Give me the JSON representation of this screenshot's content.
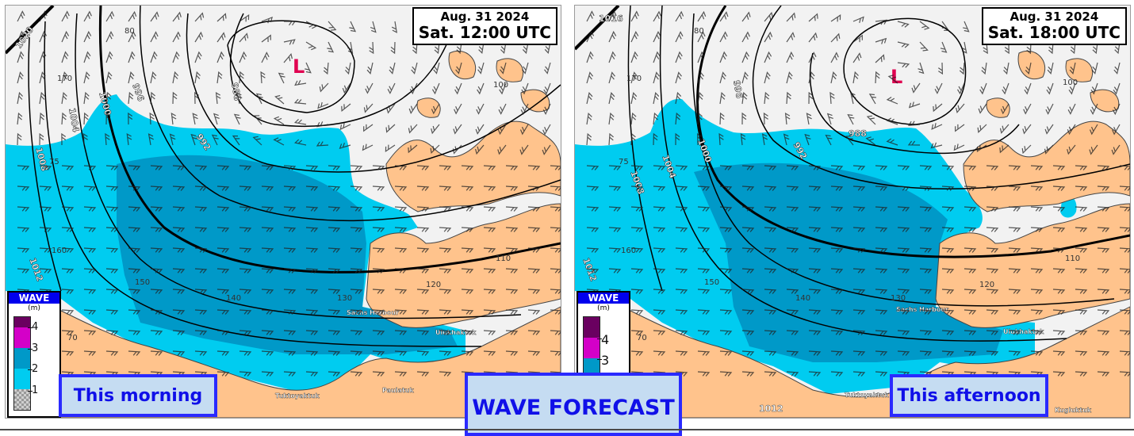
{
  "title": "WAVE FORECAST",
  "colors": {
    "sea_ice_bg": "#f2f2f2",
    "land": "#ffc38c",
    "wave_1_2": "#00ccf0",
    "wave_2_3": "#0099c8",
    "wave_3_4": "#d400c8",
    "wave_4_plus": "#6a0060",
    "low_marker": "#e00050",
    "callout_bg": "#c5dcf2",
    "callout_border": "#2a2aff",
    "callout_text": "#1010e8"
  },
  "panels": [
    {
      "id": "left",
      "date": "Aug. 31 2024",
      "time": "Sat. 12:00 UTC",
      "caption": "This morning",
      "low_marker": "L",
      "isobars": [
        "1020",
        "1012",
        "1008",
        "1004",
        "1000",
        "996",
        "992",
        "988"
      ],
      "graticule_labels": [
        "80",
        "170",
        "75",
        "160",
        "150",
        "140",
        "130",
        "120",
        "110",
        "70",
        "100"
      ],
      "places": [
        "Sachs Harbour",
        "Ulukhaktok",
        "Tuktoyaktuk",
        "Paulatuk"
      ]
    },
    {
      "id": "right",
      "date": "Aug. 31 2024",
      "time": "Sat. 18:00 UTC",
      "caption": "This afternoon",
      "low_marker": "L",
      "isobars": [
        "1016",
        "1012",
        "1008",
        "1004",
        "1000",
        "996",
        "992",
        "988"
      ],
      "graticule_labels": [
        "80",
        "170",
        "75",
        "160",
        "150",
        "140",
        "130",
        "120",
        "110",
        "70",
        "100"
      ],
      "places": [
        "Sachs Harbour",
        "Ulukhaktok",
        "Tuktoyaktuk",
        "Kugluktuk"
      ]
    }
  ],
  "legend": {
    "title": "WAVE",
    "unit": "(m)",
    "ticks": [
      "4",
      "3",
      "2",
      "1"
    ]
  }
}
